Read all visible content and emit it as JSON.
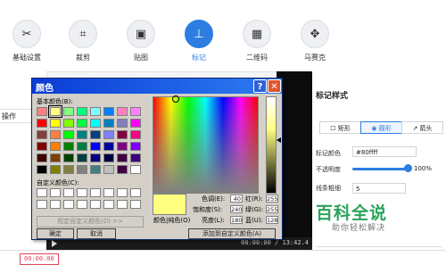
{
  "toolbar": {
    "tools": [
      {
        "label": "基础设置",
        "icon": "scissors-icon"
      },
      {
        "label": "裁剪",
        "icon": "crop-icon"
      },
      {
        "label": "贴图",
        "icon": "image-icon"
      },
      {
        "label": "标记",
        "icon": "pin-icon"
      },
      {
        "label": "二维码",
        "icon": "qrcode-icon"
      },
      {
        "label": "马赛克",
        "icon": "mosaic-icon"
      }
    ],
    "active": "标记"
  },
  "left_pane": {
    "ops_label": "操作"
  },
  "player": {
    "time_display": "00:00:00 / 13:42.4"
  },
  "timeline": {
    "timecode": "00:00.00"
  },
  "right_panel": {
    "title": "标记样式",
    "shapes": [
      "矩形",
      "圆形",
      "箭头"
    ],
    "active_shape": "圆形",
    "color_label": "标记颜色",
    "color_value": "#80ffff",
    "opacity_label": "不透明度",
    "opacity_value": "100%",
    "opacity_fraction": 1.0,
    "line_width_label": "线条粗细",
    "line_width_value": "5",
    "watermark_main": "百科全说",
    "watermark_sub": "助你轻松解决"
  },
  "color_dialog": {
    "title": "颜色",
    "basic_colors_label": "基本颜色(B):",
    "custom_colors_label": "自定义颜色(C):",
    "define_custom_label": "规定自定义颜色(D) >>",
    "ok_label": "确定",
    "cancel_label": "取消",
    "hue_label": "色调(E):",
    "hue_value": "40",
    "sat_label": "饱和度(S):",
    "sat_value": "240",
    "lum_label": "亮度(L):",
    "lum_value": "180",
    "red_label": "红(R):",
    "red_value": "255",
    "green_label": "绿(G):",
    "green_value": "255",
    "blue_label": "蓝(U):",
    "blue_value": "128",
    "color_solid_label": "颜色|纯色(O)",
    "add_custom_label": "添加到自定义颜色(A)",
    "basic_colors": [
      "#ff8080",
      "#ffff80",
      "#80ff80",
      "#00ff80",
      "#80ffff",
      "#0080ff",
      "#ff80c0",
      "#ff80ff",
      "#ff0000",
      "#ffff00",
      "#80ff00",
      "#00ff40",
      "#00ffff",
      "#0080c0",
      "#8080c0",
      "#ff00ff",
      "#804040",
      "#ff8040",
      "#00ff00",
      "#008080",
      "#004080",
      "#8080ff",
      "#800040",
      "#ff0080",
      "#800000",
      "#ff8000",
      "#008000",
      "#008040",
      "#0000ff",
      "#0000a0",
      "#800080",
      "#8000ff",
      "#400000",
      "#804000",
      "#004000",
      "#004040",
      "#000080",
      "#000040",
      "#400040",
      "#400080",
      "#000000",
      "#808000",
      "#808040",
      "#808080",
      "#408080",
      "#c0c0c0",
      "#400040",
      "#ffffff"
    ],
    "selected_index": 1
  }
}
